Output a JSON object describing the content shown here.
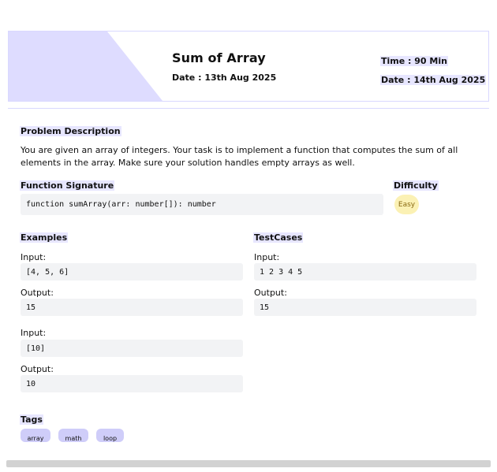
{
  "header": {
    "title": "Sum of Array",
    "date_left": "Date : 13th Aug 2025",
    "time": "Time : 90 Min",
    "date_right": "Date : 14th Aug 2025",
    "accent_color": "#dedcff"
  },
  "problem": {
    "heading": "Problem Description",
    "description": "You are given an array of integers. Your task is to implement a function that computes the sum of all elements in the array. Make sure your solution handles empty arrays as well."
  },
  "function_signature": {
    "heading": "Function Signature",
    "code": "function sumArray(arr: number[]): number"
  },
  "difficulty": {
    "heading": "Difficulty",
    "value": "Easy",
    "color": "#fbf1b4"
  },
  "examples": {
    "heading": "Examples",
    "items": [
      {
        "input_label": "Input:",
        "input": "[4, 5, 6]",
        "output_label": "Output:",
        "output": "15"
      },
      {
        "input_label": "Input:",
        "input": "[10]",
        "output_label": "Output:",
        "output": "10"
      }
    ]
  },
  "testcases": {
    "heading": "TestCases",
    "items": [
      {
        "input_label": "Input:",
        "input": "1 2 3 4 5",
        "output_label": "Output:",
        "output": "15"
      }
    ]
  },
  "tags": {
    "heading": "Tags",
    "items": [
      "array",
      "math",
      "loop"
    ],
    "color": "#cfcdf9"
  }
}
